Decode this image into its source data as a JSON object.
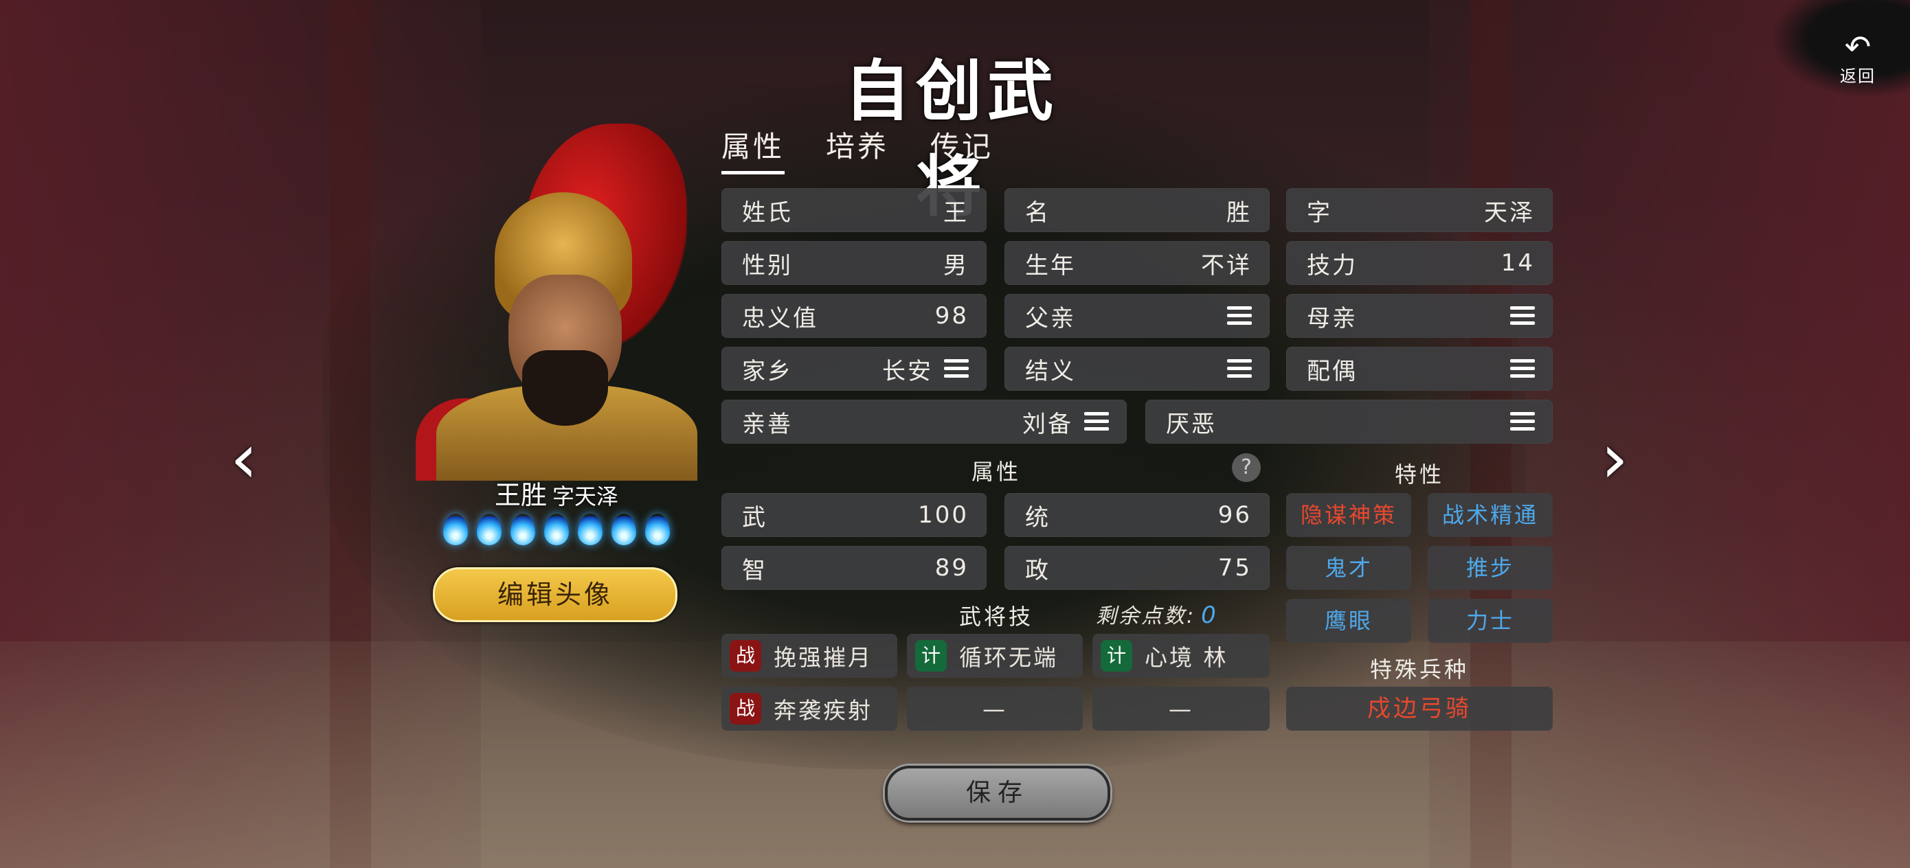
{
  "title": "自创武将",
  "back": {
    "label": "返回",
    "icon": "undo-arrow-icon"
  },
  "tabs": [
    {
      "label": "属性",
      "active": true
    },
    {
      "label": "培养",
      "active": false
    },
    {
      "label": "传记",
      "active": false
    }
  ],
  "hero": {
    "name": "王胜",
    "courtesy": "字天泽",
    "flame_count": 7,
    "edit_avatar_label": "编辑头像"
  },
  "fields": {
    "surname": {
      "label": "姓氏",
      "value": "王"
    },
    "given": {
      "label": "名",
      "value": "胜"
    },
    "courtesy": {
      "label": "字",
      "value": "天泽"
    },
    "gender": {
      "label": "性别",
      "value": "男"
    },
    "birth": {
      "label": "生年",
      "value": "不详"
    },
    "skill_power": {
      "label": "技力",
      "value": "14"
    },
    "loyalty": {
      "label": "忠义值",
      "value": "98"
    },
    "father": {
      "label": "父亲",
      "value": ""
    },
    "mother": {
      "label": "母亲",
      "value": ""
    },
    "hometown": {
      "label": "家乡",
      "value": "长安"
    },
    "sworn": {
      "label": "结义",
      "value": ""
    },
    "spouse": {
      "label": "配偶",
      "value": ""
    },
    "likes": {
      "label": "亲善",
      "value": "刘备"
    },
    "dislikes": {
      "label": "厌恶",
      "value": ""
    }
  },
  "attributes": {
    "heading": "属性",
    "wu": {
      "label": "武",
      "value": "100"
    },
    "tong": {
      "label": "统",
      "value": "96"
    },
    "zhi": {
      "label": "智",
      "value": "89"
    },
    "zheng": {
      "label": "政",
      "value": "75"
    }
  },
  "traits": {
    "heading": "特性",
    "items": [
      {
        "label": "隐谋神策",
        "color": "#e8482e"
      },
      {
        "label": "战术精通",
        "color": "#4ea8ea"
      },
      {
        "label": "鬼才",
        "color": "#4ea8ea"
      },
      {
        "label": "推步",
        "color": "#4ea8ea"
      },
      {
        "label": "鹰眼",
        "color": "#4ea8ea"
      },
      {
        "label": "力士",
        "color": "#4ea8ea"
      }
    ]
  },
  "skills": {
    "heading": "武将技",
    "remaining_label": "剩余点数:",
    "remaining_value": "0",
    "items": [
      {
        "badge": "战",
        "label": "挽强摧月"
      },
      {
        "badge": "计",
        "label": "循环无端"
      },
      {
        "badge": "计",
        "label": "心境 林"
      },
      {
        "badge": "战",
        "label": "奔袭疾射"
      },
      {
        "badge": "",
        "label": "—"
      },
      {
        "badge": "",
        "label": "—"
      }
    ]
  },
  "special_unit": {
    "heading": "特殊兵种",
    "value": "戍边弓骑"
  },
  "save_label": "保存"
}
